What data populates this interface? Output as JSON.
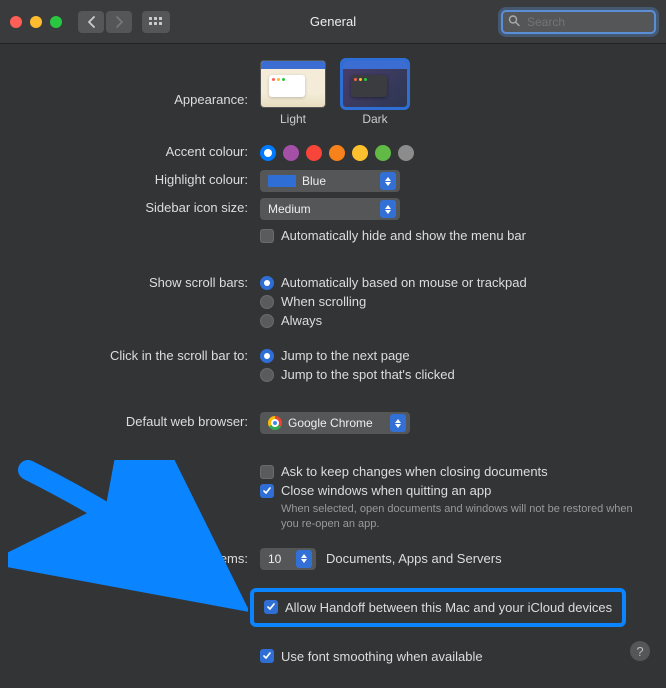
{
  "window": {
    "title": "General"
  },
  "search": {
    "placeholder": "Search",
    "value": ""
  },
  "labels": {
    "appearance": "Appearance:",
    "accent": "Accent colour:",
    "highlight": "Highlight colour:",
    "sidebarSize": "Sidebar icon size:",
    "scrollBars": "Show scroll bars:",
    "clickScroll": "Click in the scroll bar to:",
    "defaultBrowser": "Default web browser:",
    "recentItems": "Recent items:",
    "recentSuffix": "Documents, Apps and Servers"
  },
  "appearance": {
    "light": "Light",
    "dark": "Dark",
    "selected": "dark"
  },
  "accentColours": [
    {
      "hex": "#007aff",
      "selected": true
    },
    {
      "hex": "#a550a7",
      "selected": false
    },
    {
      "hex": "#f7453a",
      "selected": false
    },
    {
      "hex": "#f7821b",
      "selected": false
    },
    {
      "hex": "#fdc02e",
      "selected": false
    },
    {
      "hex": "#62ba46",
      "selected": false
    },
    {
      "hex": "#8c8c8c",
      "selected": false
    }
  ],
  "highlight": {
    "value": "Blue"
  },
  "sidebarSize": {
    "value": "Medium"
  },
  "menubar": {
    "autohide": {
      "label": "Automatically hide and show the menu bar",
      "checked": false
    }
  },
  "scroll": {
    "auto": "Automatically based on mouse or trackpad",
    "whenScrolling": "When scrolling",
    "always": "Always",
    "selected": "auto"
  },
  "click": {
    "nextPage": "Jump to the next page",
    "spot": "Jump to the spot that's clicked",
    "selected": "nextPage"
  },
  "browser": {
    "value": "Google Chrome"
  },
  "docs": {
    "askToKeep": {
      "label": "Ask to keep changes when closing documents",
      "checked": false
    },
    "closeWindows": {
      "label": "Close windows when quitting an app",
      "checked": true
    },
    "closeHint": "When selected, open documents and windows will not be restored when you re-open an app."
  },
  "recent": {
    "value": "10"
  },
  "handoff": {
    "label": "Allow Handoff between this Mac and your iCloud devices",
    "checked": true
  },
  "fontSmoothing": {
    "label": "Use font smoothing when available",
    "checked": true
  }
}
